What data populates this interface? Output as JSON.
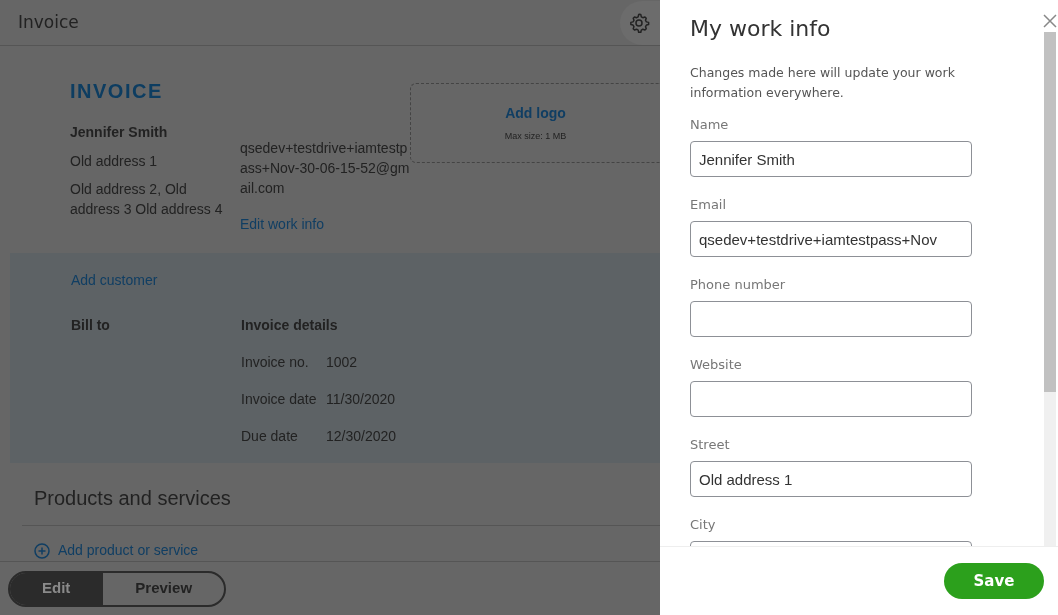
{
  "header": {
    "title": "Invoice"
  },
  "invoice": {
    "heading": "INVOICE",
    "company": {
      "name": "Jennifer Smith",
      "address_lines": [
        "Old address 1",
        "Old address 2, Old address 3 Old address 4"
      ],
      "email": "qsedev+testdrive+iamtestpass+Nov-30-06-15-52@gmail.com",
      "edit_link": "Edit work info"
    },
    "logo": {
      "label": "Add logo",
      "hint": "Max size: 1 MB"
    },
    "add_customer": "Add customer",
    "bill_to": "Bill to",
    "details_heading": "Invoice details",
    "details": [
      {
        "label": "Invoice no.",
        "value": "1002"
      },
      {
        "label": "Invoice date",
        "value": "11/30/2020"
      },
      {
        "label": "Due date",
        "value": "12/30/2020"
      }
    ]
  },
  "products": {
    "heading": "Products and services",
    "add_label": "Add product or service"
  },
  "view_toggle": [
    {
      "label": "Edit",
      "selected": true
    },
    {
      "label": "Preview",
      "selected": false
    }
  ],
  "panel": {
    "title": "My work info",
    "description": "Changes made here will update your work information everywhere.",
    "fields": [
      {
        "label": "Name",
        "value": "Jennifer Smith"
      },
      {
        "label": "Email",
        "value": "qsedev+testdrive+iamtestpass+Nov"
      },
      {
        "label": "Phone number"
      },
      {
        "label": "Website"
      },
      {
        "label": "Street",
        "value": "Old address 1"
      },
      {
        "label": "City"
      }
    ],
    "save": "Save"
  }
}
